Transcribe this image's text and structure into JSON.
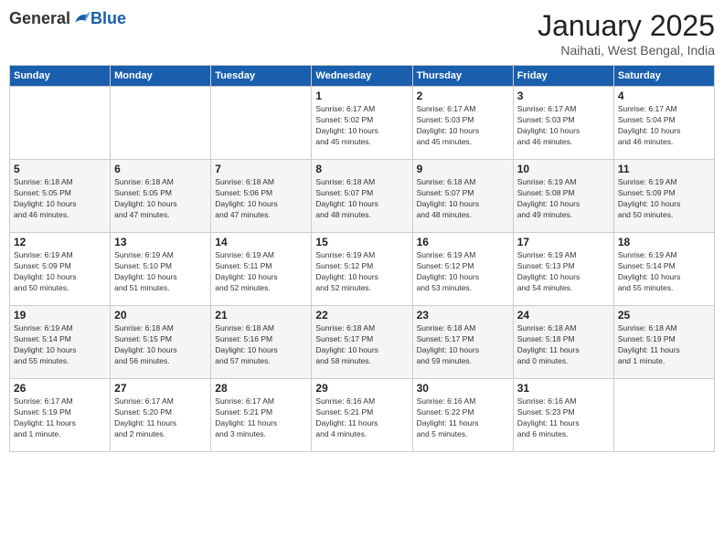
{
  "logo": {
    "general": "General",
    "blue": "Blue"
  },
  "title": "January 2025",
  "location": "Naihati, West Bengal, India",
  "days_header": [
    "Sunday",
    "Monday",
    "Tuesday",
    "Wednesday",
    "Thursday",
    "Friday",
    "Saturday"
  ],
  "weeks": [
    [
      {
        "day": "",
        "info": ""
      },
      {
        "day": "",
        "info": ""
      },
      {
        "day": "",
        "info": ""
      },
      {
        "day": "1",
        "info": "Sunrise: 6:17 AM\nSunset: 5:02 PM\nDaylight: 10 hours\nand 45 minutes."
      },
      {
        "day": "2",
        "info": "Sunrise: 6:17 AM\nSunset: 5:03 PM\nDaylight: 10 hours\nand 45 minutes."
      },
      {
        "day": "3",
        "info": "Sunrise: 6:17 AM\nSunset: 5:03 PM\nDaylight: 10 hours\nand 46 minutes."
      },
      {
        "day": "4",
        "info": "Sunrise: 6:17 AM\nSunset: 5:04 PM\nDaylight: 10 hours\nand 46 minutes."
      }
    ],
    [
      {
        "day": "5",
        "info": "Sunrise: 6:18 AM\nSunset: 5:05 PM\nDaylight: 10 hours\nand 46 minutes."
      },
      {
        "day": "6",
        "info": "Sunrise: 6:18 AM\nSunset: 5:05 PM\nDaylight: 10 hours\nand 47 minutes."
      },
      {
        "day": "7",
        "info": "Sunrise: 6:18 AM\nSunset: 5:06 PM\nDaylight: 10 hours\nand 47 minutes."
      },
      {
        "day": "8",
        "info": "Sunrise: 6:18 AM\nSunset: 5:07 PM\nDaylight: 10 hours\nand 48 minutes."
      },
      {
        "day": "9",
        "info": "Sunrise: 6:18 AM\nSunset: 5:07 PM\nDaylight: 10 hours\nand 48 minutes."
      },
      {
        "day": "10",
        "info": "Sunrise: 6:19 AM\nSunset: 5:08 PM\nDaylight: 10 hours\nand 49 minutes."
      },
      {
        "day": "11",
        "info": "Sunrise: 6:19 AM\nSunset: 5:09 PM\nDaylight: 10 hours\nand 50 minutes."
      }
    ],
    [
      {
        "day": "12",
        "info": "Sunrise: 6:19 AM\nSunset: 5:09 PM\nDaylight: 10 hours\nand 50 minutes."
      },
      {
        "day": "13",
        "info": "Sunrise: 6:19 AM\nSunset: 5:10 PM\nDaylight: 10 hours\nand 51 minutes."
      },
      {
        "day": "14",
        "info": "Sunrise: 6:19 AM\nSunset: 5:11 PM\nDaylight: 10 hours\nand 52 minutes."
      },
      {
        "day": "15",
        "info": "Sunrise: 6:19 AM\nSunset: 5:12 PM\nDaylight: 10 hours\nand 52 minutes."
      },
      {
        "day": "16",
        "info": "Sunrise: 6:19 AM\nSunset: 5:12 PM\nDaylight: 10 hours\nand 53 minutes."
      },
      {
        "day": "17",
        "info": "Sunrise: 6:19 AM\nSunset: 5:13 PM\nDaylight: 10 hours\nand 54 minutes."
      },
      {
        "day": "18",
        "info": "Sunrise: 6:19 AM\nSunset: 5:14 PM\nDaylight: 10 hours\nand 55 minutes."
      }
    ],
    [
      {
        "day": "19",
        "info": "Sunrise: 6:19 AM\nSunset: 5:14 PM\nDaylight: 10 hours\nand 55 minutes."
      },
      {
        "day": "20",
        "info": "Sunrise: 6:18 AM\nSunset: 5:15 PM\nDaylight: 10 hours\nand 56 minutes."
      },
      {
        "day": "21",
        "info": "Sunrise: 6:18 AM\nSunset: 5:16 PM\nDaylight: 10 hours\nand 57 minutes."
      },
      {
        "day": "22",
        "info": "Sunrise: 6:18 AM\nSunset: 5:17 PM\nDaylight: 10 hours\nand 58 minutes."
      },
      {
        "day": "23",
        "info": "Sunrise: 6:18 AM\nSunset: 5:17 PM\nDaylight: 10 hours\nand 59 minutes."
      },
      {
        "day": "24",
        "info": "Sunrise: 6:18 AM\nSunset: 5:18 PM\nDaylight: 11 hours\nand 0 minutes."
      },
      {
        "day": "25",
        "info": "Sunrise: 6:18 AM\nSunset: 5:19 PM\nDaylight: 11 hours\nand 1 minute."
      }
    ],
    [
      {
        "day": "26",
        "info": "Sunrise: 6:17 AM\nSunset: 5:19 PM\nDaylight: 11 hours\nand 1 minute."
      },
      {
        "day": "27",
        "info": "Sunrise: 6:17 AM\nSunset: 5:20 PM\nDaylight: 11 hours\nand 2 minutes."
      },
      {
        "day": "28",
        "info": "Sunrise: 6:17 AM\nSunset: 5:21 PM\nDaylight: 11 hours\nand 3 minutes."
      },
      {
        "day": "29",
        "info": "Sunrise: 6:16 AM\nSunset: 5:21 PM\nDaylight: 11 hours\nand 4 minutes."
      },
      {
        "day": "30",
        "info": "Sunrise: 6:16 AM\nSunset: 5:22 PM\nDaylight: 11 hours\nand 5 minutes."
      },
      {
        "day": "31",
        "info": "Sunrise: 6:16 AM\nSunset: 5:23 PM\nDaylight: 11 hours\nand 6 minutes."
      },
      {
        "day": "",
        "info": ""
      }
    ]
  ]
}
